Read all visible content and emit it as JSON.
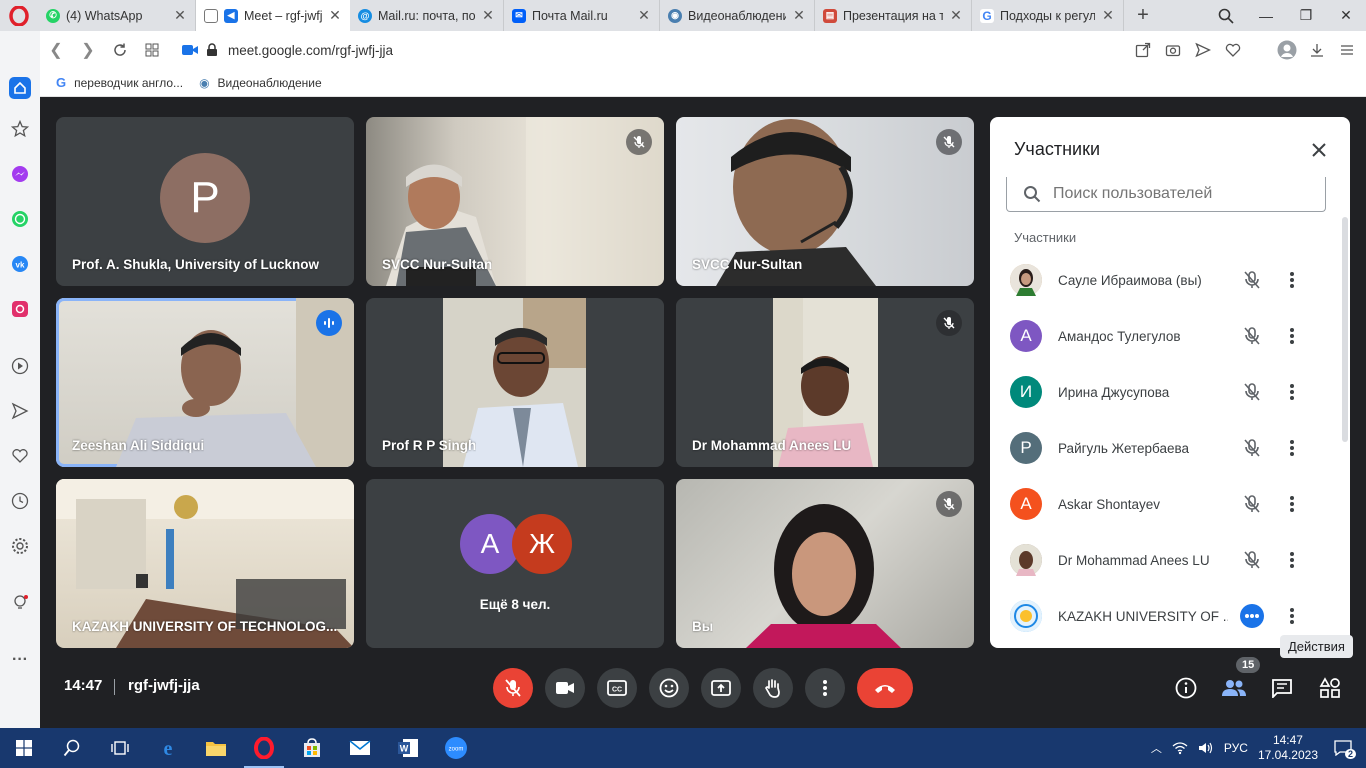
{
  "browser": {
    "tabs": [
      {
        "title": "(4) WhatsApp",
        "fav": "#25d366",
        "active": false
      },
      {
        "title": "Meet – rgf-jwfj-",
        "fav": "#1a73e8",
        "active": true
      },
      {
        "title": "Mail.ru: почта, пои",
        "fav": "#168de2",
        "active": false
      },
      {
        "title": "Почта Mail.ru",
        "fav": "#005ff9",
        "active": false
      },
      {
        "title": "Видеонаблюдение",
        "fav": "#4a7fb0",
        "active": false
      },
      {
        "title": "Презентация на те",
        "fav": "#d04a3b",
        "active": false
      },
      {
        "title": "Подходы к регулир",
        "fav": "#4285f4",
        "active": false
      }
    ],
    "url": "meet.google.com/rgf-jwfj-jja",
    "bookmarks": [
      {
        "label": "переводчик англо..."
      },
      {
        "label": "Видеонаблюдение"
      }
    ]
  },
  "tiles": [
    {
      "name": "Prof. A. Shukla, University of Lucknow",
      "avatar_letter": "P",
      "muted": false
    },
    {
      "name": "SVCC Nur-Sultan",
      "muted": true
    },
    {
      "name": "SVCC Nur-Sultan",
      "muted": true
    },
    {
      "name": "Zeeshan Ali Siddiqui",
      "speaking": true
    },
    {
      "name": "Prof R P Singh",
      "muted": false
    },
    {
      "name": "Dr Mohammad Anees LU",
      "muted": true
    },
    {
      "name": "KAZAKH UNIVERSITY OF TECHNOLOG...",
      "muted": false
    },
    {
      "name": "Ещё 8 чел.",
      "letters": [
        "А",
        "Ж"
      ]
    },
    {
      "name": "Вы",
      "muted": true
    }
  ],
  "panel": {
    "title": "Участники",
    "search_placeholder": "Поиск пользователей",
    "section_label": "Участники",
    "participants": [
      {
        "name": "Сауле Ибраимова (вы)",
        "letter": "",
        "color": "#c9a87c",
        "photo": true
      },
      {
        "name": "Амандос Тулегулов",
        "letter": "А",
        "color": "#7e57c2"
      },
      {
        "name": "Ирина Джусупова",
        "letter": "И",
        "color": "#00897b"
      },
      {
        "name": "Райгуль Жетербаева",
        "letter": "Р",
        "color": "#546e7a"
      },
      {
        "name": "Askar Shontayev",
        "letter": "A",
        "color": "#f4511e"
      },
      {
        "name": "Dr Mohammad Anees LU",
        "letter": "",
        "color": "#a1887f",
        "photo": true
      },
      {
        "name": "KAZAKH UNIVERSITY OF ...",
        "letter": "",
        "color": "#64b5f6",
        "photo": true
      }
    ]
  },
  "meeting": {
    "time": "14:47",
    "code": "rgf-jwfj-jja",
    "participant_count": "15",
    "tooltip": "Действия"
  },
  "taskbar": {
    "lang": "РУС",
    "time": "14:47",
    "date": "17.04.2023",
    "notifications": "2"
  }
}
